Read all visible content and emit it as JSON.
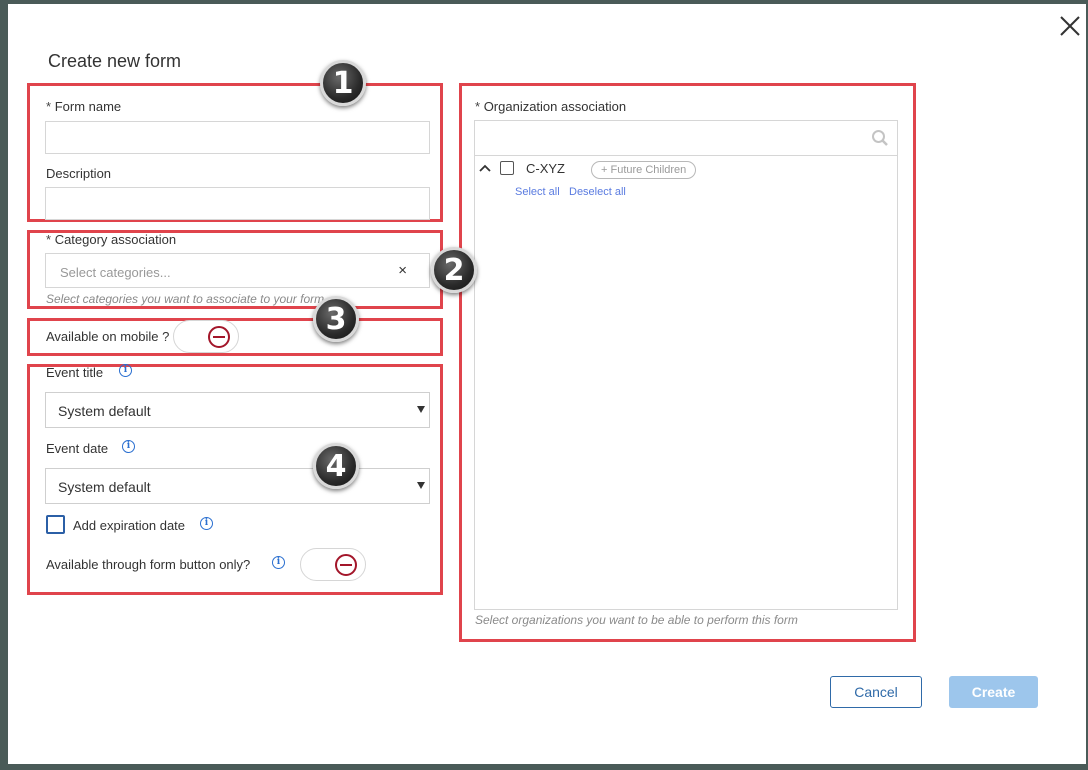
{
  "modal": {
    "title": "Create new form",
    "close_icon": "close-icon"
  },
  "form_name": {
    "required_mark": "*",
    "label": "Form name",
    "value": ""
  },
  "description": {
    "label": "Description",
    "value": ""
  },
  "category": {
    "required_mark": "*",
    "label": "Category association",
    "placeholder": "Select categories...",
    "clear_glyph": "×",
    "hint": "Select categories you want to associate to your form"
  },
  "mobile": {
    "label": "Available on mobile ?",
    "state": "off"
  },
  "event_title": {
    "label": "Event title",
    "selected": "System default"
  },
  "event_date": {
    "label": "Event date",
    "selected": "System default"
  },
  "expiration": {
    "label": "Add expiration date",
    "checked": false
  },
  "form_button_only": {
    "label": "Available through form button only?",
    "state": "off"
  },
  "organization": {
    "required_mark": "*",
    "label": "Organization association",
    "search_value": "",
    "tree": [
      {
        "name": "C-XYZ",
        "expanded": true,
        "checked": false,
        "future_children_label": "+ Future Children"
      }
    ],
    "select_all": "Select all",
    "deselect_all": "Deselect all",
    "hint": "Select organizations you want to be able to perform this form"
  },
  "badges": [
    "1",
    "2",
    "3",
    "4"
  ],
  "buttons": {
    "cancel": "Cancel",
    "create": "Create"
  },
  "colors": {
    "highlight": "#e0444c",
    "primary": "#2f6aa8",
    "toggle_off": "#a3162a",
    "create_disabled": "#9dc6ec"
  }
}
